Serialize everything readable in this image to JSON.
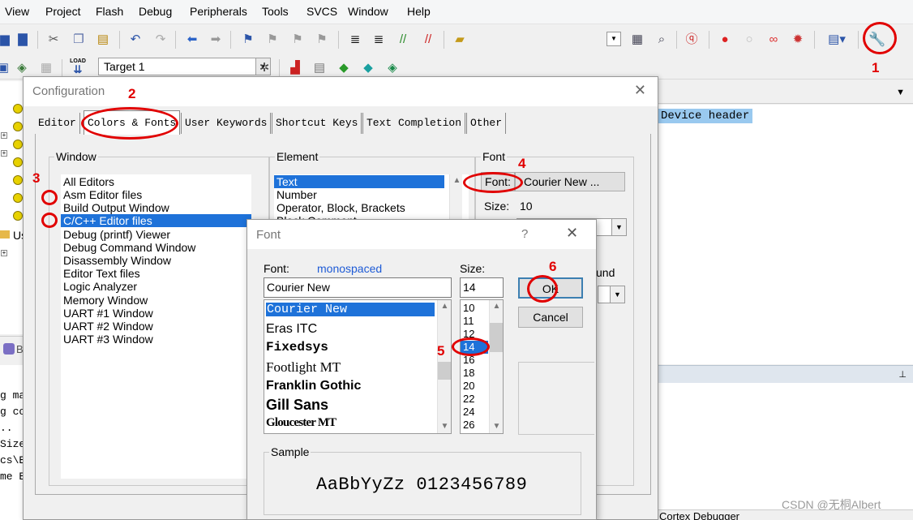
{
  "menu": [
    "View",
    "Project",
    "Flash",
    "Debug",
    "Peripherals",
    "Tools",
    "SVCS",
    "Window",
    "Help"
  ],
  "toolbar": {
    "target": "Target 1",
    "load_label": "LOAD"
  },
  "tree": {
    "group_label": "Us"
  },
  "build_output": {
    "lines": [
      "g ma",
      "g co",
      "..",
      "Size",
      "cs\\E",
      "me E"
    ],
    "tab_label": "B"
  },
  "editor": {
    "highlight_line": "Device header"
  },
  "bottom_right": {
    "tab_label": "Cortex Debugger"
  },
  "watermark": "CSDN @无桐Albert",
  "config": {
    "title": "Configuration",
    "tabs": [
      "Editor",
      "Colors & Fonts",
      "User Keywords",
      "Shortcut Keys",
      "Text Completion",
      "Other"
    ],
    "window_group": "Window",
    "windows": [
      "All Editors",
      "Asm Editor files",
      "Build Output Window",
      "C/C++ Editor files",
      "Debug (printf) Viewer",
      "Debug Command Window",
      "Disassembly Window",
      "Editor Text files",
      "Logic Analyzer",
      "Memory Window",
      "UART #1 Window",
      "UART #2 Window",
      "UART #3 Window"
    ],
    "element_group": "Element",
    "elements": [
      "Text",
      "Number",
      "Operator, Block, Brackets",
      "Block Comment"
    ],
    "font_group": "Font",
    "font_button": "Font:",
    "font_value": "Courier New ...",
    "size_label": "Size:",
    "size_value": "10",
    "partial_label": "und"
  },
  "font_dialog": {
    "title": "Font",
    "help": "?",
    "font_label": "Font:",
    "font_hint": "monospaced",
    "font_value": "Courier New",
    "faces": [
      "Courier New",
      "Eras ITC",
      "Fixedsys",
      "Footlight MT",
      "Franklin Gothic",
      "Gill Sans",
      "Gloucester MT"
    ],
    "size_label": "Size:",
    "size_value": "14",
    "sizes": [
      "10",
      "11",
      "12",
      "14",
      "16",
      "18",
      "20",
      "22",
      "24",
      "26"
    ],
    "ok": "OK",
    "cancel": "Cancel",
    "sample_label": "Sample",
    "sample_text": "AaBbYyZz 0123456789"
  },
  "annotations": [
    "1",
    "2",
    "3",
    "4",
    "5",
    "6"
  ],
  "colors": {
    "annotation": "#e10000",
    "selection": "#1e72d9",
    "editor_highlight": "#99c9ef"
  }
}
